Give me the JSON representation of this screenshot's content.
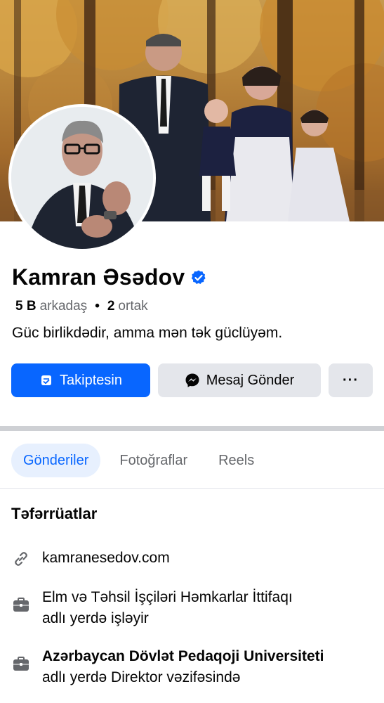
{
  "profile": {
    "name": "Kamran Əsədov",
    "friends_count": "5 B",
    "friends_label": "arkadaş",
    "mutual_count": "2",
    "mutual_label": "ortak",
    "bio": "Güc birlikdədir, amma mən tək güclüyəm."
  },
  "actions": {
    "follow_label": "Takiptesin",
    "message_label": "Mesaj Gönder",
    "more_label": "···"
  },
  "tabs": [
    {
      "label": "Gönderiler",
      "active": true
    },
    {
      "label": "Fotoğraflar",
      "active": false
    },
    {
      "label": "Reels",
      "active": false
    }
  ],
  "details": {
    "title": "Təfərrüatlar",
    "website": "kamranesedov.com",
    "work1_line1": "Elm və Təhsil İşçiləri Həmkarlar İttifaqı",
    "work1_line2": "adlı yerdə işləyir",
    "work2_line1": "Azərbaycan Dövlət Pedaqoji Universiteti",
    "work2_line2": "adlı yerdə Direktor vəzifəsində"
  },
  "colors": {
    "accent": "#0866ff",
    "secondary_button": "#e4e6eb",
    "muted_text": "#65676b",
    "active_tab_bg": "#e7f0fe"
  },
  "icons": {
    "verified": "verified-badge-icon",
    "follow": "follow-check-icon",
    "message": "messenger-icon",
    "website": "link-icon",
    "work": "briefcase-icon"
  }
}
